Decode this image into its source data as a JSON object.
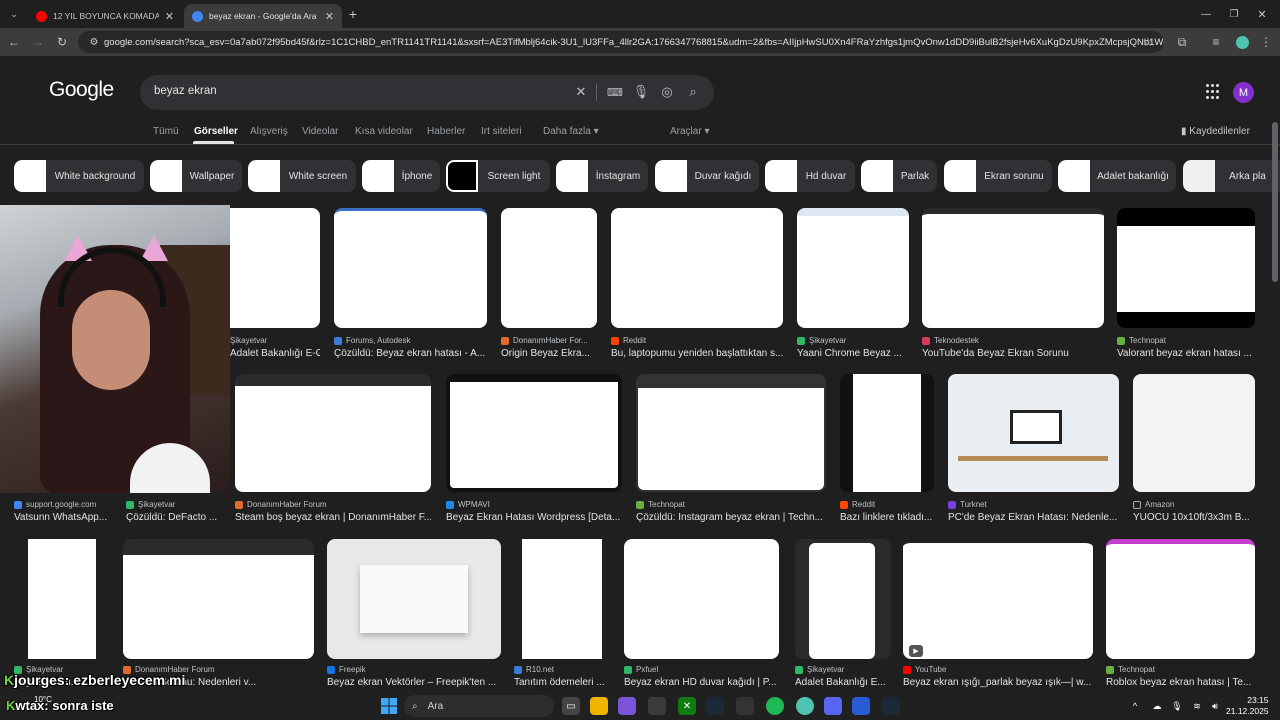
{
  "browser": {
    "tabs": [
      {
        "label": "12 YIL BOYUNCA KOMADA SA",
        "favicon_color": "#ff0000"
      },
      {
        "label": "beyaz ekran - Google'da Ara",
        "favicon_color": "#4285f4"
      }
    ],
    "new_tab_icon": "plus-icon",
    "url": "google.com/search?sca_esv=0a7ab072f95bd45f&rlz=1C1CHBD_enTR1141TR1141&sxsrf=AE3TifMblj64cik-3U1_lU3FFa_4llr2GA:1766347768815&udm=2&fbs=AIIjpHwSU0Xn4FRaYzhfgs1jmQvOnw1dDD9iiBulB2fsjeHv6XuKgDzU9KpxZMcpsjQNb1WcU..."
  },
  "google": {
    "logo": "Google",
    "query": "beyaz ekran",
    "account_initial": "M",
    "account_color": "#8430ce",
    "nav": [
      "Tümü",
      "Görseller",
      "Alışveriş",
      "Videolar",
      "Kısa videolar",
      "Haberler",
      "Irt siteleri",
      "Daha fazla",
      "Araçlar"
    ],
    "saved": "Kaydedilenler",
    "chips": [
      "White background",
      "Wallpaper",
      "White screen",
      "İphone",
      "Screen light",
      "İnstagram",
      "Duvar kağıdı",
      "Hd duvar",
      "Parlak",
      "Ekran sorunu",
      "Adalet bakanlığı",
      "Arka pla"
    ]
  },
  "results": [
    {
      "source": "Şikayetvar",
      "title": "Adalet Bakanlığı E-Gö..."
    },
    {
      "source": "Forums, Autodesk",
      "title": "Çözüldü: Beyaz ekran hatası - A..."
    },
    {
      "source": "DonanımHaber For...",
      "title": "Origin Beyaz Ekra..."
    },
    {
      "source": "Reddit",
      "title": "Bu, laptopumu yeniden başlattıktan s..."
    },
    {
      "source": "Şikayetvar",
      "title": "Yaani Chrome Beyaz ..."
    },
    {
      "source": "Teknodestek",
      "title": "YouTube'da Beyaz Ekran Sorunu"
    },
    {
      "source": "Technopat",
      "title": "Valorant beyaz ekran hatası ..."
    },
    {
      "source": "support.google.com",
      "title": "Vatsunn WhatsApp..."
    },
    {
      "source": "Şikayetvar",
      "title": "Çözüldü: DeFacto ..."
    },
    {
      "source": "DonanımHaber Forum",
      "title": "Steam boş beyaz ekran | DonanımHaber F..."
    },
    {
      "source": "WPMAVI",
      "title": "Beyaz Ekran Hatası Wordpress [Deta..."
    },
    {
      "source": "Technopat",
      "title": "Çözüldü: Instagram beyaz ekran | Techn..."
    },
    {
      "source": "Reddit",
      "title": "Bazı linklere tıkladı..."
    },
    {
      "source": "Turknet",
      "title": "PC'de Beyaz Ekran Hatası: Nedenle..."
    },
    {
      "source": "Amazon",
      "title": "YUOCU 10x10ft/3x3m B..."
    },
    {
      "source": "Şikayetvar",
      "title": "Beyaz Ekran..."
    },
    {
      "source": "DonanımHaber Forum",
      "title": "...Ekran Sorunu: Nedenleri v..."
    },
    {
      "source": "Freepik",
      "title": "Beyaz ekran Vektörler – Freepik'ten ..."
    },
    {
      "source": "R10.net",
      "title": "Tanıtım ödemeleri ..."
    },
    {
      "source": "Pxfuel",
      "title": "Beyaz ekran HD duvar kağıdı | P..."
    },
    {
      "source": "Şikayetvar",
      "title": "Adalet Bakanlığı E..."
    },
    {
      "source": "YouTube",
      "title": "Beyaz ekran ışığı_parlak beyaz ışık—| w..."
    },
    {
      "source": "Technopat",
      "title": "Roblox beyaz ekran hatası | Te..."
    }
  ],
  "overlay": {
    "chat1_user": "jourges",
    "chat1_msg": "ezberleyecem mi",
    "chat2_user": "wtax",
    "chat2_msg": ": sonra iste"
  },
  "taskbar": {
    "weather_temp": "10°C",
    "search_placeholder": "Ara",
    "time": "23:15",
    "date": "21.12.2025"
  }
}
